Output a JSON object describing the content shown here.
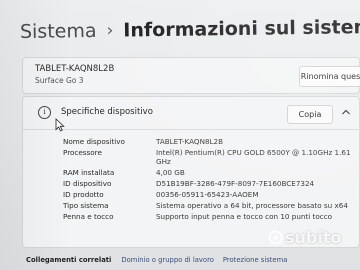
{
  "breadcrumb": {
    "parent": "Sistema",
    "separator": "›",
    "current": "Informazioni sul sistema"
  },
  "device": {
    "name": "TABLET-KAQN8L2B",
    "model": "Surface Go 3",
    "rename_label": "Rinomina questo PC"
  },
  "specs": {
    "title": "Specifiche dispositivo",
    "copy_label": "Copia",
    "rows": [
      {
        "label": "Nome dispositivo",
        "value": "TABLET-KAQN8L2B"
      },
      {
        "label": "Processore",
        "value": "Intel(R) Pentium(R) CPU GOLD 6500Y @ 1.10GHz   1.61 GHz"
      },
      {
        "label": "RAM installata",
        "value": "4,00 GB"
      },
      {
        "label": "ID dispositivo",
        "value": "D51B19BF-3286-479F-8097-7E160BCE7324"
      },
      {
        "label": "ID prodotto",
        "value": "00356-05911-65423-AAOEM"
      },
      {
        "label": "Tipo sistema",
        "value": "Sistema operativo a 64 bit, processore basato su x64"
      },
      {
        "label": "Penna e tocco",
        "value": "Supporto input penna e tocco con 10 punti tocco"
      }
    ]
  },
  "links": {
    "label": "Collegamenti correlati",
    "items": [
      "Dominio o gruppo di lavoro",
      "Protezione sistema"
    ]
  },
  "watermark": "subito",
  "icons": {
    "info": "info-icon",
    "collapse": "chevron-up-icon",
    "cursor": "mouse-pointer-icon"
  }
}
